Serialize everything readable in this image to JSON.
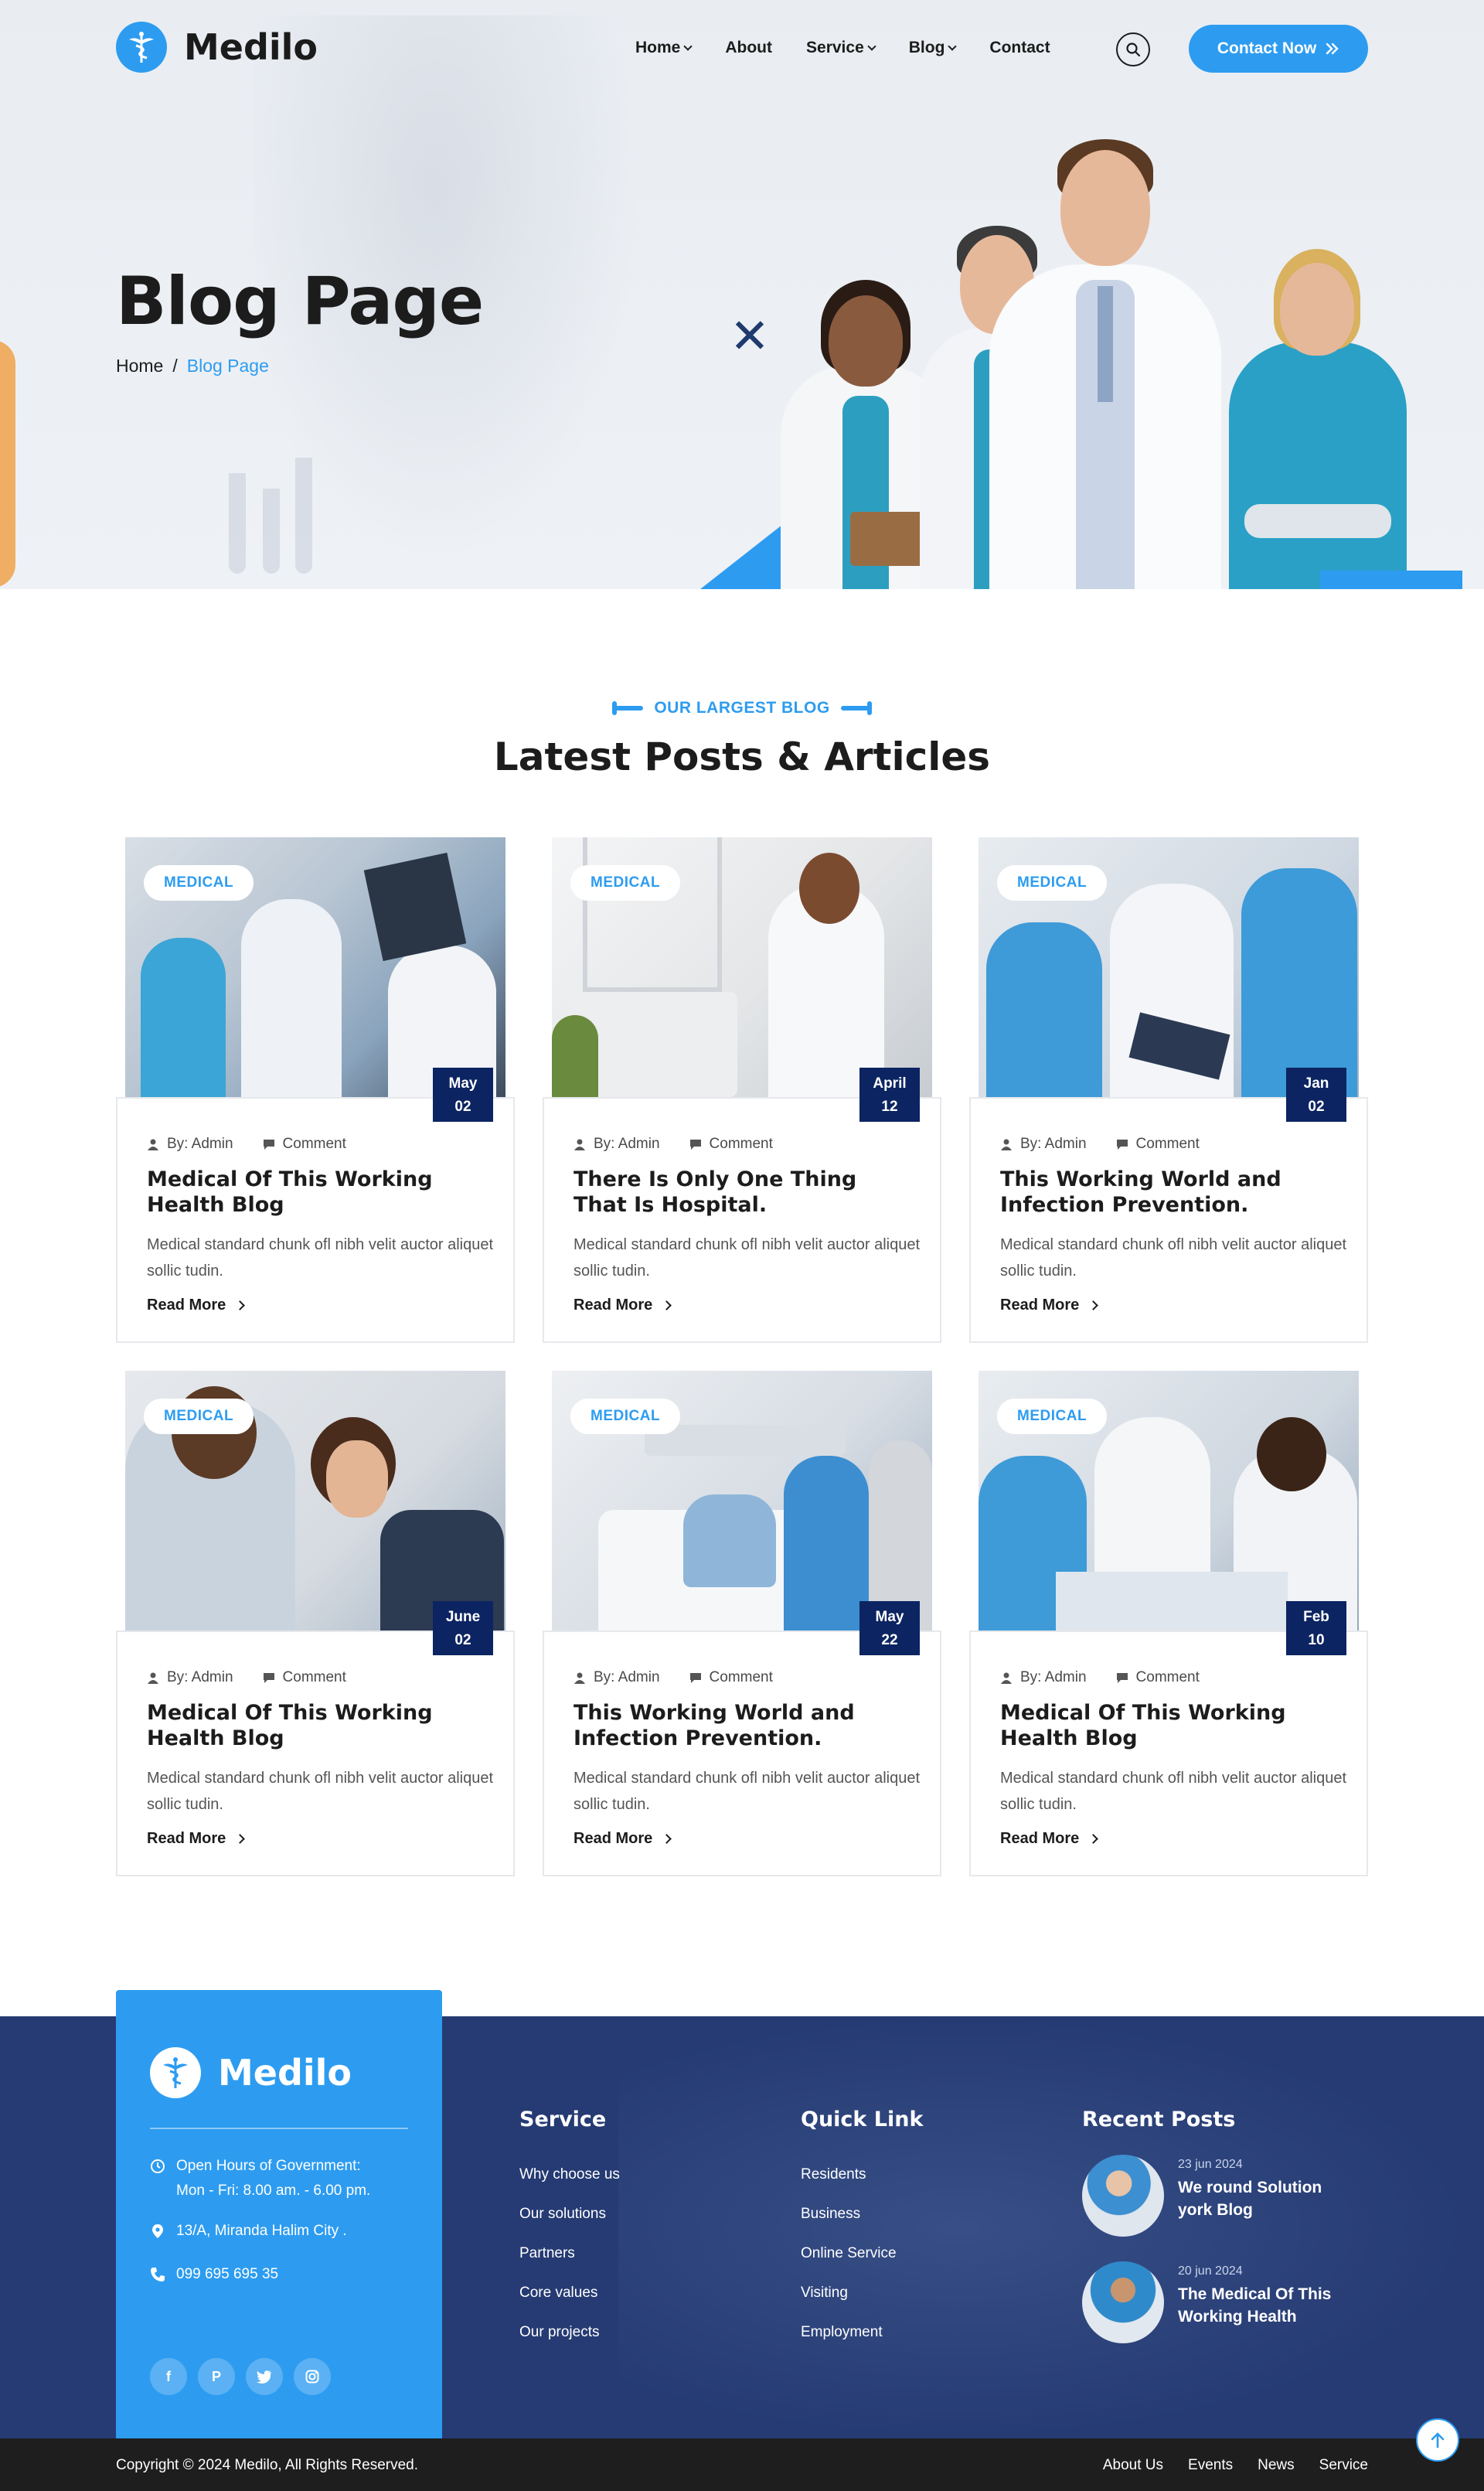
{
  "brand": {
    "name": "Medilo"
  },
  "nav": {
    "items": [
      {
        "label": "Home",
        "has_dropdown": true
      },
      {
        "label": "About",
        "has_dropdown": false
      },
      {
        "label": "Service",
        "has_dropdown": true
      },
      {
        "label": "Blog",
        "has_dropdown": true
      },
      {
        "label": "Contact",
        "has_dropdown": false
      }
    ],
    "cta_label": "Contact Now"
  },
  "hero": {
    "title": "Blog Page",
    "breadcrumb": {
      "home": "Home",
      "separator": "/",
      "current": "Blog Page"
    }
  },
  "section": {
    "eyebrow": "OUR LARGEST BLOG",
    "title": "Latest Posts & Articles"
  },
  "posts": [
    {
      "tag": "MEDICAL",
      "month": "May",
      "day": "02",
      "author": "By: Admin",
      "comment": "Comment",
      "title": "Medical Of This Working Health Blog",
      "excerpt": "Medical standard chunk ofl nibh velit auctor aliquet sollic tudin.",
      "read_more": "Read More"
    },
    {
      "tag": "MEDICAL",
      "month": "April",
      "day": "12",
      "author": "By: Admin",
      "comment": "Comment",
      "title": "There Is Only One Thing That Is Hospital.",
      "excerpt": "Medical standard chunk ofl nibh velit auctor aliquet sollic tudin.",
      "read_more": "Read More"
    },
    {
      "tag": "MEDICAL",
      "month": "Jan",
      "day": "02",
      "author": "By: Admin",
      "comment": "Comment",
      "title": "This Working World and Infection Prevention.",
      "excerpt": "Medical standard chunk ofl nibh velit auctor aliquet sollic tudin.",
      "read_more": "Read More"
    },
    {
      "tag": "MEDICAL",
      "month": "June",
      "day": "02",
      "author": "By: Admin",
      "comment": "Comment",
      "title": "Medical Of This Working Health Blog",
      "excerpt": "Medical standard chunk ofl nibh velit auctor aliquet sollic tudin.",
      "read_more": "Read More"
    },
    {
      "tag": "MEDICAL",
      "month": "May",
      "day": "22",
      "author": "By: Admin",
      "comment": "Comment",
      "title": "This Working World and Infection Prevention.",
      "excerpt": "Medical standard chunk ofl nibh velit auctor aliquet sollic tudin.",
      "read_more": "Read More"
    },
    {
      "tag": "MEDICAL",
      "month": "Feb",
      "day": "10",
      "author": "By: Admin",
      "comment": "Comment",
      "title": "Medical Of This Working Health Blog",
      "excerpt": "Medical standard chunk ofl nibh velit auctor aliquet sollic tudin.",
      "read_more": "Read More"
    }
  ],
  "footer": {
    "hours_label": "Open Hours of Government:",
    "hours_value": "Mon - Fri: 8.00 am. - 6.00 pm.",
    "address": "13/A, Miranda Halim City .",
    "phone": "099 695 695 35",
    "socials": [
      "facebook-icon",
      "pinterest-icon",
      "twitter-icon",
      "instagram-icon"
    ],
    "service": {
      "title": "Service",
      "links": [
        "Why choose us",
        "Our solutions",
        "Partners",
        "Core values",
        "Our projects"
      ]
    },
    "quick": {
      "title": "Quick Link",
      "links": [
        "Residents",
        "Business",
        "Online Service",
        "Visiting",
        "Employment"
      ]
    },
    "recent": {
      "title": "Recent Posts",
      "posts": [
        {
          "date": "23 jun 2024",
          "title": "We round Solution york Blog"
        },
        {
          "date": "20 jun 2024",
          "title": "The Medical Of This Working Health"
        }
      ]
    },
    "copyright": "Copyright © 2024 Medilo, All Rights Reserved.",
    "bottom_links": [
      "About Us",
      "Events",
      "News",
      "Service"
    ]
  },
  "colors": {
    "accent": "#2d9cf0",
    "navy": "#0c2462",
    "footer": "#263b73",
    "dark": "#1c1c1c"
  }
}
